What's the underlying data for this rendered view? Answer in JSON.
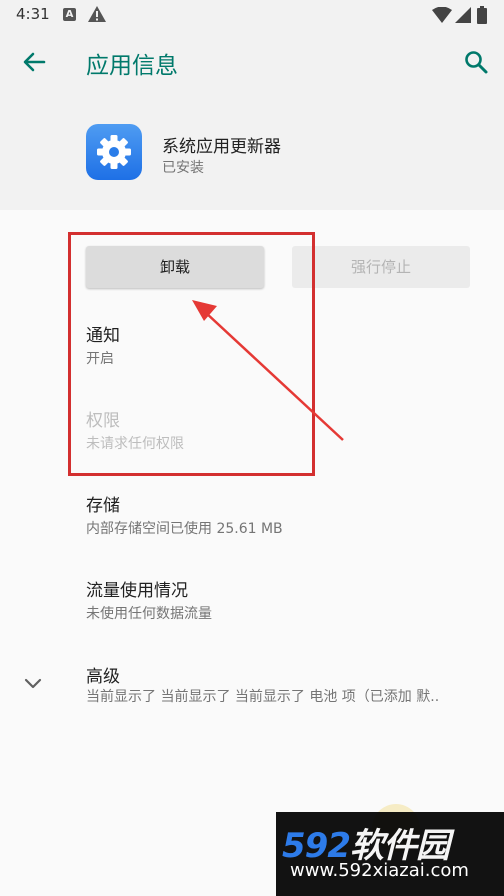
{
  "status_bar": {
    "time": "4:31",
    "notification_badge": "A"
  },
  "header": {
    "title": "应用信息"
  },
  "app": {
    "name": "系统应用更新器",
    "status": "已安装"
  },
  "buttons": {
    "uninstall": "卸载",
    "force_stop": "强行停止"
  },
  "settings": {
    "notifications": {
      "title": "通知",
      "subtitle": "开启"
    },
    "permissions": {
      "title": "权限",
      "subtitle": "未请求任何权限"
    },
    "storage": {
      "title": "存储",
      "subtitle": "内部存储空间已使用 25.61 MB"
    },
    "data_usage": {
      "title": "流量使用情况",
      "subtitle": "未使用任何数据流量"
    },
    "advanced": {
      "title": "高级",
      "subtitle": "当前显示了 当前显示了 当前显示了 电池 项（已添加 默.."
    }
  },
  "watermark": {
    "logo_num": "592",
    "logo_text": "软件园",
    "url": "www.592xiazai.com"
  },
  "colors": {
    "accent": "#00796b",
    "annotation": "#d32f2f",
    "app_icon": "#2a7de9"
  }
}
